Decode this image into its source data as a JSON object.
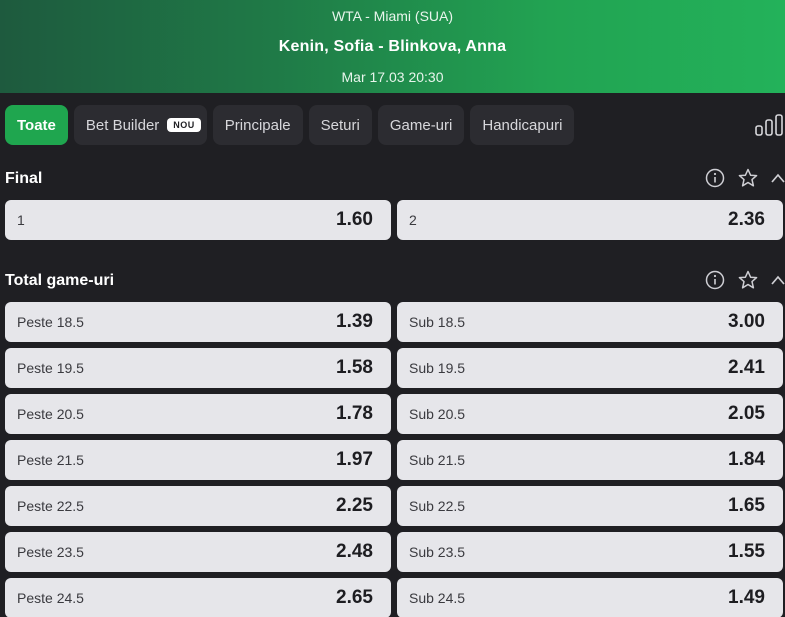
{
  "header": {
    "league": "WTA -  Miami (SUA)",
    "match": "Kenin, Sofia - Blinkova, Anna",
    "datetime": "Mar 17.03 20:30"
  },
  "tabs": [
    {
      "label": "Toate",
      "active": true
    },
    {
      "label": "Bet Builder",
      "badge": "NOU"
    },
    {
      "label": "Principale"
    },
    {
      "label": "Seturi"
    },
    {
      "label": "Game-uri"
    },
    {
      "label": "Handicapuri"
    }
  ],
  "sections": {
    "final": {
      "title": "Final",
      "odds": [
        {
          "label": "1",
          "value": "1.60"
        },
        {
          "label": "2",
          "value": "2.36"
        }
      ]
    },
    "total": {
      "title": "Total game-uri",
      "rows": [
        {
          "over_label": "Peste 18.5",
          "over_value": "1.39",
          "under_label": "Sub 18.5",
          "under_value": "3.00"
        },
        {
          "over_label": "Peste 19.5",
          "over_value": "1.58",
          "under_label": "Sub 19.5",
          "under_value": "2.41"
        },
        {
          "over_label": "Peste 20.5",
          "over_value": "1.78",
          "under_label": "Sub 20.5",
          "under_value": "2.05"
        },
        {
          "over_label": "Peste 21.5",
          "over_value": "1.97",
          "under_label": "Sub 21.5",
          "under_value": "1.84"
        },
        {
          "over_label": "Peste 22.5",
          "over_value": "2.25",
          "under_label": "Sub 22.5",
          "under_value": "1.65"
        },
        {
          "over_label": "Peste 23.5",
          "over_value": "2.48",
          "under_label": "Sub 23.5",
          "under_value": "1.55"
        },
        {
          "over_label": "Peste 24.5",
          "over_value": "2.65",
          "under_label": "Sub 24.5",
          "under_value": "1.49"
        }
      ]
    }
  },
  "colors": {
    "accent": "#1fa64f",
    "background": "#1f1f23",
    "odd_bg": "#e6e6ea"
  },
  "icons": [
    "info-icon",
    "star-icon",
    "chevron-up-icon",
    "stats-chart-icon"
  ]
}
